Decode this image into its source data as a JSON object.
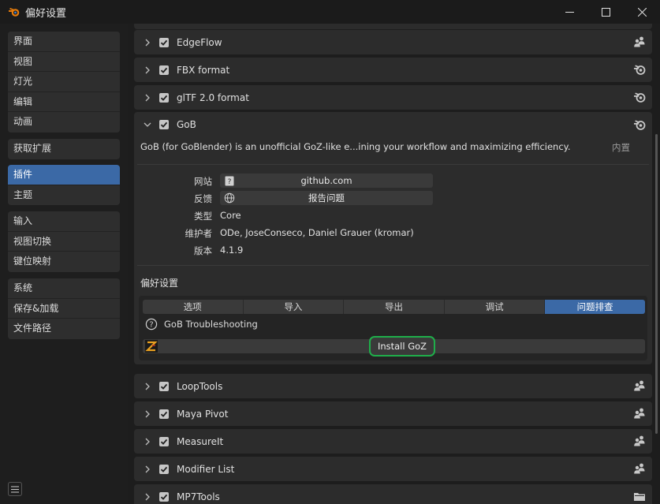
{
  "window": {
    "title": "偏好设置"
  },
  "sidebar": {
    "groups": [
      [
        "界面",
        "视图",
        "灯光",
        "编辑",
        "动画"
      ],
      [
        "获取扩展"
      ],
      [
        "插件",
        "主题"
      ],
      [
        "输入",
        "视图切换",
        "键位映射"
      ],
      [
        "系统",
        "保存&加载",
        "文件路径"
      ]
    ],
    "active": "插件"
  },
  "addons_before": [
    {
      "name": "EdgeFlow",
      "icon": "community-icon"
    },
    {
      "name": "FBX format",
      "icon": "blender-icon"
    },
    {
      "name": "glTF 2.0 format",
      "icon": "blender-icon"
    }
  ],
  "expanded": {
    "name": "GoB",
    "icon": "blender-icon",
    "description": "GoB (for GoBlender) is an unofficial GoZ-like e...ining your workflow and maximizing efficiency.",
    "builtin_label": "内置",
    "website_label": "网站",
    "website_value": "github.com",
    "feedback_label": "反馈",
    "feedback_value": "报告问题",
    "type_label": "类型",
    "type_value": "Core",
    "maintainer_label": "维护者",
    "maintainer_value": "ODe, JoseConseco, Daniel Grauer (kromar)",
    "version_label": "版本",
    "version_value": "4.1.9",
    "prefs_title": "偏好设置",
    "tabs": [
      "选项",
      "导入",
      "导出",
      "调试",
      "问题排查"
    ],
    "active_tab": "问题排查",
    "troubleshooting_label": "GoB Troubleshooting",
    "install_button": "Install GoZ"
  },
  "addons_after": [
    {
      "name": "LoopTools",
      "icon": "community-icon"
    },
    {
      "name": "Maya Pivot",
      "icon": "community-icon"
    },
    {
      "name": "MeasureIt",
      "icon": "community-icon"
    },
    {
      "name": "Modifier List",
      "icon": "community-icon"
    },
    {
      "name": "MP7Tools",
      "icon": "folder-icon"
    }
  ],
  "colors": {
    "accent": "#3b69a6",
    "highlight": "#1fae4a",
    "blender_orange": "#e87d0d"
  }
}
